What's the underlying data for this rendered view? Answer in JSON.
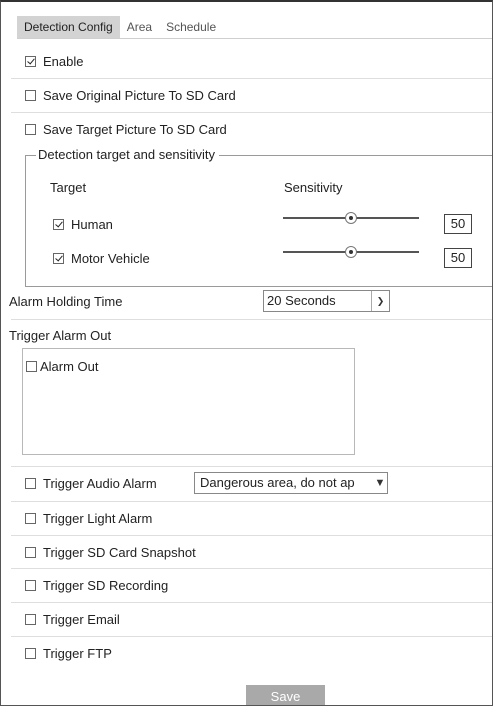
{
  "tabs": [
    {
      "label": "Detection Config",
      "active": true
    },
    {
      "label": "Area",
      "active": false
    },
    {
      "label": "Schedule",
      "active": false
    }
  ],
  "enable": {
    "label": "Enable",
    "checked": true
  },
  "save_original": {
    "label": "Save Original Picture To SD Card",
    "checked": false
  },
  "save_target": {
    "label": "Save Target Picture To SD Card",
    "checked": false
  },
  "detection_group": {
    "legend": "Detection target and sensitivity",
    "target_header": "Target",
    "sensitivity_header": "Sensitivity",
    "targets": [
      {
        "label": "Human",
        "checked": true,
        "sensitivity": "50",
        "slider_level": 0.5
      },
      {
        "label": "Motor Vehicle",
        "checked": true,
        "sensitivity": "50",
        "slider_level": 0.5
      }
    ]
  },
  "alarm_holding": {
    "label": "Alarm Holding Time",
    "value": "20 Seconds"
  },
  "trigger_alarm_out": {
    "label": "Trigger Alarm Out",
    "item_label": "Alarm Out",
    "item_checked": false
  },
  "trigger_audio": {
    "label": "Trigger Audio Alarm",
    "checked": false,
    "value": "Dangerous area, do not ap"
  },
  "trigger_light": {
    "label": "Trigger Light Alarm",
    "checked": false
  },
  "trigger_snapshot": {
    "label": "Trigger SD Card Snapshot",
    "checked": false
  },
  "trigger_recording": {
    "label": "Trigger SD Recording",
    "checked": false
  },
  "trigger_email": {
    "label": "Trigger Email",
    "checked": false
  },
  "trigger_ftp": {
    "label": "Trigger FTP",
    "checked": false
  },
  "save_label": "Save",
  "icons": {
    "checkbox": "checkbox-icon",
    "dropdown": "chevron-down-icon",
    "slider_thumb": "slider-thumb-icon"
  }
}
